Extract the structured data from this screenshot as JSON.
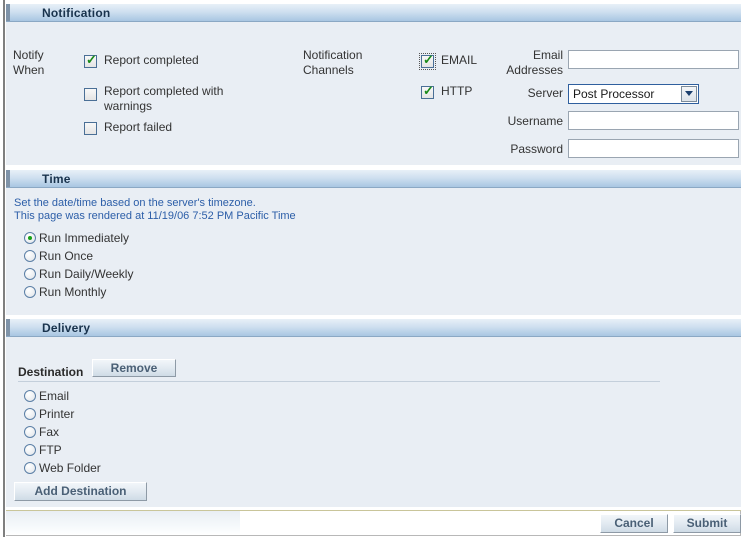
{
  "sections": {
    "notification": {
      "title": "Notification",
      "notify_when_label": "Notify\nWhen",
      "channels_label": "Notification\nChannels",
      "notify_when_options": [
        {
          "label": "Report completed",
          "checked": true
        },
        {
          "label": "Report completed with\nwarnings",
          "checked": false
        },
        {
          "label": "Report failed",
          "checked": false
        }
      ],
      "channels": [
        {
          "label": "EMAIL",
          "checked": true,
          "focused": true
        },
        {
          "label": "HTTP",
          "checked": true,
          "focused": false
        }
      ],
      "fields": {
        "email_addresses": {
          "label": "Email\nAddresses",
          "value": "",
          "placeholder": ""
        },
        "server": {
          "label": "Server",
          "value": "Post Processor",
          "options": [
            "Post Processor"
          ]
        },
        "username": {
          "label": "Username",
          "value": "",
          "placeholder": ""
        },
        "password": {
          "label": "Password",
          "value": "",
          "placeholder": ""
        }
      }
    },
    "time": {
      "title": "Time",
      "note": "Set the date/time based on the server's timezone.\nThis page was rendered at 11/19/06 7:52 PM Pacific Time",
      "options": [
        {
          "label": "Run Immediately",
          "selected": true
        },
        {
          "label": "Run Once",
          "selected": false
        },
        {
          "label": "Run Daily/Weekly",
          "selected": false
        },
        {
          "label": "Run Monthly",
          "selected": false
        }
      ]
    },
    "delivery": {
      "title": "Delivery",
      "destination_label": "Destination",
      "remove_button": "Remove",
      "options": [
        {
          "label": "Email",
          "selected": false
        },
        {
          "label": "Printer",
          "selected": false
        },
        {
          "label": "Fax",
          "selected": false
        },
        {
          "label": "FTP",
          "selected": false
        },
        {
          "label": "Web Folder",
          "selected": false
        }
      ],
      "add_destination_button": "Add Destination"
    }
  },
  "footer": {
    "cancel_button": "Cancel",
    "submit_button": "Submit"
  },
  "colors": {
    "header_gradient_start": "#e8f0f8",
    "header_gradient_end": "#a9c6e2",
    "section_body": "#e9eef4",
    "link_note": "#2c5ea8",
    "check_green": "#1a8a1a",
    "radio_border": "#5b7fa6",
    "footer_rule": "#c9c59a"
  }
}
